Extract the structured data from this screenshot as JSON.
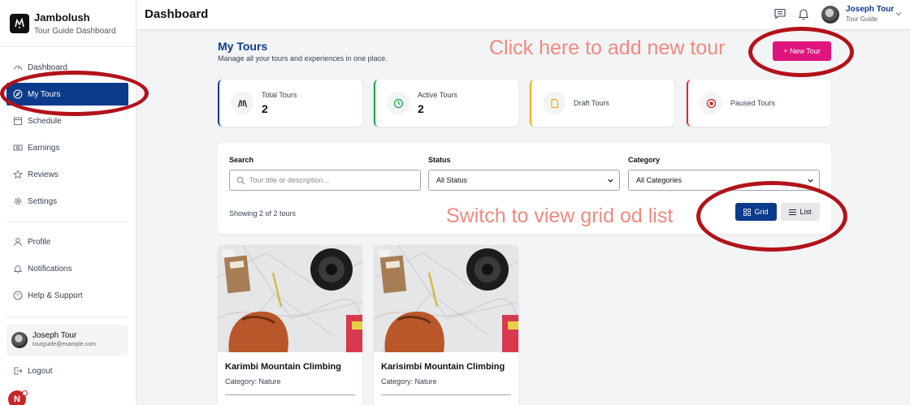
{
  "brand": {
    "name": "Jambolush",
    "subtitle": "Tour Guide Dashboard"
  },
  "sidebar": {
    "items": [
      {
        "label": "Dashboard",
        "icon": "gauge-icon"
      },
      {
        "label": "My Tours",
        "icon": "compass-icon",
        "active": true
      },
      {
        "label": "Schedule",
        "icon": "calendar-icon"
      },
      {
        "label": "Earnings",
        "icon": "money-icon"
      },
      {
        "label": "Reviews",
        "icon": "star-icon"
      },
      {
        "label": "Settings",
        "icon": "gear-icon"
      },
      {
        "label": "Profile",
        "icon": "user-icon"
      },
      {
        "label": "Notifications",
        "icon": "bell-icon"
      },
      {
        "label": "Help & Support",
        "icon": "help-icon"
      }
    ],
    "user": {
      "name": "Joseph Tour",
      "email": "tourguide@example.com"
    },
    "logout_label": "Logout",
    "badge_letter": "N"
  },
  "topbar": {
    "title": "Dashboard",
    "user_name": "Joseph Tour",
    "user_role": "Tour Guide"
  },
  "main": {
    "title": "My Tours",
    "subtitle": "Manage all your tours and experiences in one place.",
    "new_tour_label": "+ New Tour",
    "stats": [
      {
        "label": "Total Tours",
        "value": "2",
        "color": "#0d3b8c",
        "icon": "road-icon"
      },
      {
        "label": "Active Tours",
        "value": "2",
        "color": "#16a34a",
        "icon": "clock-icon"
      },
      {
        "label": "Draft Tours",
        "value": "",
        "color": "#eab308",
        "icon": "file-icon"
      },
      {
        "label": "Paused Tours",
        "value": "",
        "color": "#dc2626",
        "icon": "stop-icon"
      }
    ],
    "filters": {
      "search_label": "Search",
      "search_placeholder": "Tour title or description...",
      "status_label": "Status",
      "status_value": "All Status",
      "category_label": "Category",
      "category_value": "All Categories",
      "showing": "Showing 2 of 2 tours",
      "grid_label": "Grid",
      "list_label": "List"
    },
    "tours": [
      {
        "title": "Karimbi Mountain Climbing",
        "category": "Category: Nature"
      },
      {
        "title": "Karisimbi Mountain Climbing",
        "category": "Category: Nature"
      }
    ]
  },
  "annotations": {
    "new_tour_hint": "Click here to add new tour",
    "view_hint": "Switch to view grid od list"
  },
  "colors": {
    "primary": "#0d3b8c",
    "accent": "#e0147d",
    "annotation": "#b3121a"
  }
}
